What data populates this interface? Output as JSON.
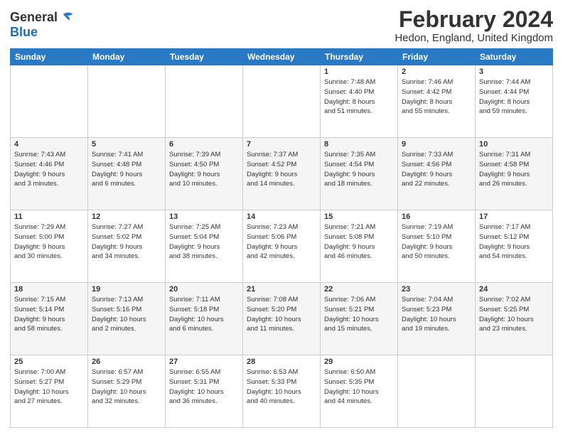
{
  "header": {
    "logo_line1": "General",
    "logo_line2": "Blue",
    "main_title": "February 2024",
    "subtitle": "Hedon, England, United Kingdom"
  },
  "days_of_week": [
    "Sunday",
    "Monday",
    "Tuesday",
    "Wednesday",
    "Thursday",
    "Friday",
    "Saturday"
  ],
  "weeks": [
    [
      {
        "day": "",
        "info": ""
      },
      {
        "day": "",
        "info": ""
      },
      {
        "day": "",
        "info": ""
      },
      {
        "day": "",
        "info": ""
      },
      {
        "day": "1",
        "info": "Sunrise: 7:48 AM\nSunset: 4:40 PM\nDaylight: 8 hours\nand 51 minutes."
      },
      {
        "day": "2",
        "info": "Sunrise: 7:46 AM\nSunset: 4:42 PM\nDaylight: 8 hours\nand 55 minutes."
      },
      {
        "day": "3",
        "info": "Sunrise: 7:44 AM\nSunset: 4:44 PM\nDaylight: 8 hours\nand 59 minutes."
      }
    ],
    [
      {
        "day": "4",
        "info": "Sunrise: 7:43 AM\nSunset: 4:46 PM\nDaylight: 9 hours\nand 3 minutes."
      },
      {
        "day": "5",
        "info": "Sunrise: 7:41 AM\nSunset: 4:48 PM\nDaylight: 9 hours\nand 6 minutes."
      },
      {
        "day": "6",
        "info": "Sunrise: 7:39 AM\nSunset: 4:50 PM\nDaylight: 9 hours\nand 10 minutes."
      },
      {
        "day": "7",
        "info": "Sunrise: 7:37 AM\nSunset: 4:52 PM\nDaylight: 9 hours\nand 14 minutes."
      },
      {
        "day": "8",
        "info": "Sunrise: 7:35 AM\nSunset: 4:54 PM\nDaylight: 9 hours\nand 18 minutes."
      },
      {
        "day": "9",
        "info": "Sunrise: 7:33 AM\nSunset: 4:56 PM\nDaylight: 9 hours\nand 22 minutes."
      },
      {
        "day": "10",
        "info": "Sunrise: 7:31 AM\nSunset: 4:58 PM\nDaylight: 9 hours\nand 26 minutes."
      }
    ],
    [
      {
        "day": "11",
        "info": "Sunrise: 7:29 AM\nSunset: 5:00 PM\nDaylight: 9 hours\nand 30 minutes."
      },
      {
        "day": "12",
        "info": "Sunrise: 7:27 AM\nSunset: 5:02 PM\nDaylight: 9 hours\nand 34 minutes."
      },
      {
        "day": "13",
        "info": "Sunrise: 7:25 AM\nSunset: 5:04 PM\nDaylight: 9 hours\nand 38 minutes."
      },
      {
        "day": "14",
        "info": "Sunrise: 7:23 AM\nSunset: 5:06 PM\nDaylight: 9 hours\nand 42 minutes."
      },
      {
        "day": "15",
        "info": "Sunrise: 7:21 AM\nSunset: 5:08 PM\nDaylight: 9 hours\nand 46 minutes."
      },
      {
        "day": "16",
        "info": "Sunrise: 7:19 AM\nSunset: 5:10 PM\nDaylight: 9 hours\nand 50 minutes."
      },
      {
        "day": "17",
        "info": "Sunrise: 7:17 AM\nSunset: 5:12 PM\nDaylight: 9 hours\nand 54 minutes."
      }
    ],
    [
      {
        "day": "18",
        "info": "Sunrise: 7:15 AM\nSunset: 5:14 PM\nDaylight: 9 hours\nand 58 minutes."
      },
      {
        "day": "19",
        "info": "Sunrise: 7:13 AM\nSunset: 5:16 PM\nDaylight: 10 hours\nand 2 minutes."
      },
      {
        "day": "20",
        "info": "Sunrise: 7:11 AM\nSunset: 5:18 PM\nDaylight: 10 hours\nand 6 minutes."
      },
      {
        "day": "21",
        "info": "Sunrise: 7:08 AM\nSunset: 5:20 PM\nDaylight: 10 hours\nand 11 minutes."
      },
      {
        "day": "22",
        "info": "Sunrise: 7:06 AM\nSunset: 5:21 PM\nDaylight: 10 hours\nand 15 minutes."
      },
      {
        "day": "23",
        "info": "Sunrise: 7:04 AM\nSunset: 5:23 PM\nDaylight: 10 hours\nand 19 minutes."
      },
      {
        "day": "24",
        "info": "Sunrise: 7:02 AM\nSunset: 5:25 PM\nDaylight: 10 hours\nand 23 minutes."
      }
    ],
    [
      {
        "day": "25",
        "info": "Sunrise: 7:00 AM\nSunset: 5:27 PM\nDaylight: 10 hours\nand 27 minutes."
      },
      {
        "day": "26",
        "info": "Sunrise: 6:57 AM\nSunset: 5:29 PM\nDaylight: 10 hours\nand 32 minutes."
      },
      {
        "day": "27",
        "info": "Sunrise: 6:55 AM\nSunset: 5:31 PM\nDaylight: 10 hours\nand 36 minutes."
      },
      {
        "day": "28",
        "info": "Sunrise: 6:53 AM\nSunset: 5:33 PM\nDaylight: 10 hours\nand 40 minutes."
      },
      {
        "day": "29",
        "info": "Sunrise: 6:50 AM\nSunset: 5:35 PM\nDaylight: 10 hours\nand 44 minutes."
      },
      {
        "day": "",
        "info": ""
      },
      {
        "day": "",
        "info": ""
      }
    ]
  ]
}
